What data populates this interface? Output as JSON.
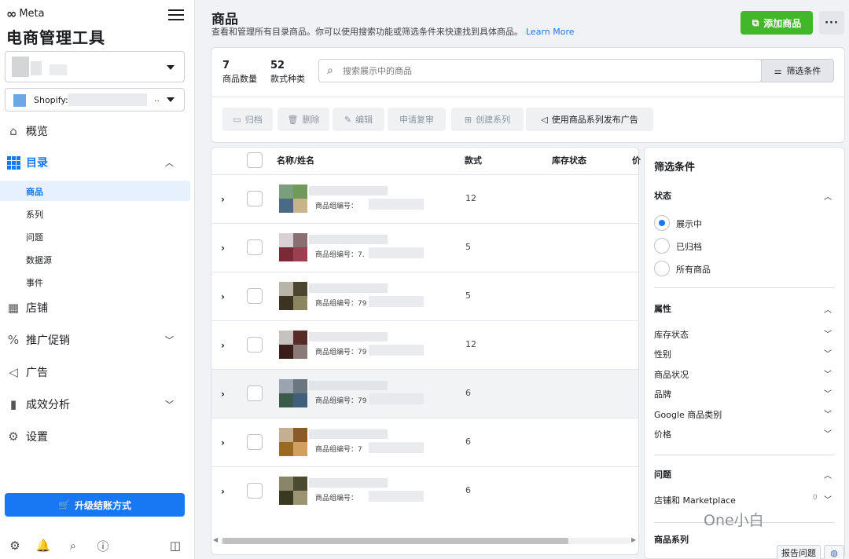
{
  "sidebar": {
    "brand": "Meta",
    "app_title": "电商管理工具",
    "shop_label": "Shopify:",
    "shop_ellipsis": "..",
    "nav": [
      {
        "key": "overview",
        "label": "概览",
        "icon": "home-icon"
      },
      {
        "key": "catalog",
        "label": "目录",
        "icon": "grid-icon",
        "active": true,
        "expanded": true
      },
      {
        "key": "shops",
        "label": "店铺",
        "icon": "shop-icon"
      },
      {
        "key": "promotions",
        "label": "推广促销",
        "icon": "percent-icon",
        "collapsible": true
      },
      {
        "key": "ads",
        "label": "广告",
        "icon": "megaphone-icon"
      },
      {
        "key": "insights",
        "label": "成效分析",
        "icon": "bar-chart-icon",
        "collapsible": true
      },
      {
        "key": "settings",
        "label": "设置",
        "icon": "gear-icon"
      }
    ],
    "catalog_sub": [
      {
        "label": "商品",
        "active": true
      },
      {
        "label": "系列"
      },
      {
        "label": "问题"
      },
      {
        "label": "数据源"
      },
      {
        "label": "事件"
      }
    ],
    "upgrade_label": "升级结账方式"
  },
  "header": {
    "title": "商品",
    "description": "查看和管理所有目录商品。你可以使用搜索功能或筛选条件来快速找到具体商品。",
    "learn_more": "Learn More",
    "add_product": "添加商品",
    "more": "···"
  },
  "stats": [
    {
      "value": "7",
      "label": "商品数量"
    },
    {
      "value": "52",
      "label": "款式种类"
    }
  ],
  "search": {
    "placeholder": "搜索展示中的商品",
    "value": ""
  },
  "filter_button": "筛选条件",
  "toolbar": [
    {
      "label": "归档",
      "icon": "archive-icon",
      "enabled": false
    },
    {
      "label": "删除",
      "icon": "trash-icon",
      "enabled": false
    },
    {
      "label": "编辑",
      "icon": "pencil-icon",
      "enabled": false
    },
    {
      "label": "申请复审",
      "icon": "",
      "enabled": false
    },
    {
      "label": "创建系列",
      "icon": "collection-icon",
      "enabled": false
    },
    {
      "label": "使用商品系列发布广告",
      "icon": "megaphone-icon",
      "enabled": true
    }
  ],
  "table": {
    "columns": [
      "名称/姓名",
      "款式",
      "库存状态",
      "价"
    ],
    "rows": [
      {
        "group_label": "商品组编号：",
        "group_id_visible": "",
        "variants": "12",
        "colors": [
          "#7a9e7e",
          "#6f9a5a",
          "#4b6a86",
          "#c9b48a"
        ]
      },
      {
        "group_label": "商品组编号：",
        "group_id_visible": "7.",
        "variants": "5",
        "colors": [
          "#d8d0d4",
          "#8a6f72",
          "#7a2a35",
          "#9a4050"
        ]
      },
      {
        "group_label": "商品组编号：",
        "group_id_visible": "79",
        "variants": "5",
        "colors": [
          "#b8b4a8",
          "#4a4630",
          "#3c3420",
          "#8a8660"
        ]
      },
      {
        "group_label": "商品组编号：",
        "group_id_visible": "79",
        "variants": "12",
        "colors": [
          "#c6c2c0",
          "#5a2a28",
          "#3a1c18",
          "#8a7a78"
        ]
      },
      {
        "group_label": "商品组编号：",
        "group_id_visible": "79",
        "variants": "6",
        "colors": [
          "#9aa4b0",
          "#6a7680",
          "#3a5a4a",
          "#3f5f7a"
        ],
        "highlight": true
      },
      {
        "group_label": "商品组编号：",
        "group_id_visible": "7",
        "variants": "6",
        "colors": [
          "#c4b090",
          "#8a5a28",
          "#9a6a20",
          "#d0a060"
        ]
      },
      {
        "group_label": "商品组编号：",
        "group_id_visible": "",
        "variants": "6",
        "colors": [
          "#8a8468",
          "#4a4a30",
          "#3a3a22",
          "#9a9470"
        ]
      }
    ]
  },
  "filters": {
    "title": "筛选条件",
    "status": {
      "label": "状态",
      "options": [
        {
          "label": "展示中",
          "selected": true
        },
        {
          "label": "已归档",
          "selected": false
        },
        {
          "label": "所有商品",
          "selected": false
        }
      ]
    },
    "attributes": {
      "label": "属性",
      "items": [
        "库存状态",
        "性别",
        "商品状况",
        "品牌",
        "Google 商品类别",
        "价格"
      ]
    },
    "issues": {
      "label": "问题",
      "items": [
        {
          "label": "店铺和 Marketplace",
          "count": "0"
        }
      ]
    },
    "product_sets": {
      "label": "商品系列"
    }
  },
  "footer": {
    "report": "报告问题",
    "watermark": "One小白"
  }
}
